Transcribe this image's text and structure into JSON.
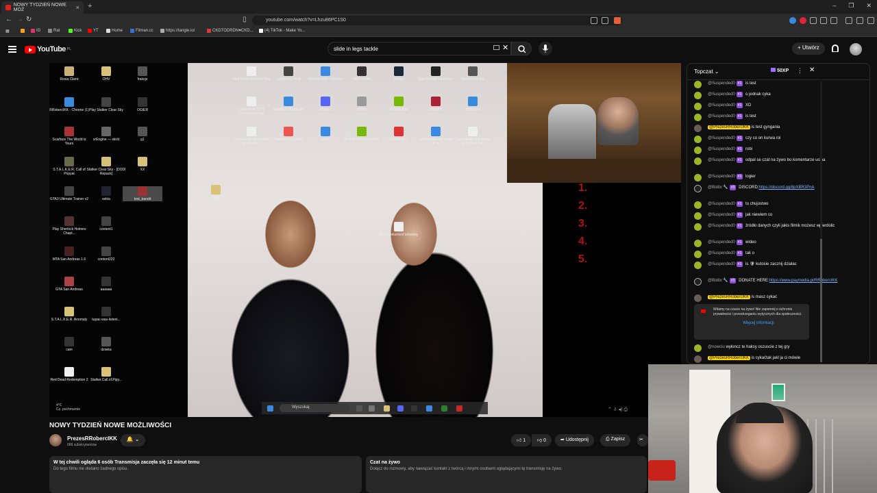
{
  "browser": {
    "tab_title": "NOWY TYDZIEŃ NOWE MOŻ",
    "tab_close": "×",
    "new_tab": "+",
    "url": "youtube.com/watch?v=Lhzu86PC1S0",
    "window_controls": [
      "–",
      "❐",
      "✕"
    ],
    "bookmarks": [
      {
        "label": "IG",
        "color": "#e1306c"
      },
      {
        "label": "Rat",
        "color": "#888888"
      },
      {
        "label": "Kick",
        "color": "#53fc18"
      },
      {
        "label": "YT",
        "color": "#ff0000"
      },
      {
        "label": "Home",
        "color": "#dddddd"
      },
      {
        "label": "Filman.cc",
        "color": "#3b6fd1"
      },
      {
        "label": "https://tangle.io/",
        "color": "#aaaaaa"
      },
      {
        "label": "CKDTODRDN♥CKD...",
        "color": "#d63a3a"
      },
      {
        "label": "(4) TikTok - Make Yo...",
        "color": "#ffffff"
      }
    ]
  },
  "youtube": {
    "logo_text": "YouTube",
    "logo_region": "PL",
    "search_value": "slide in legs tackle",
    "search_clear": "✕",
    "create_label": "Utwórz",
    "create_plus": "+"
  },
  "desktop": {
    "icons": [
      {
        "label": "Resia Client",
        "color": "#c9b27a"
      },
      {
        "label": "OHV",
        "color": "#d8c27a"
      },
      {
        "label": "frakcje",
        "color": "#555"
      },
      {
        "label": "RRobercIKK - Chrome (1)",
        "color": "#3a8be0"
      },
      {
        "label": "Play Stalker Clear Sky",
        "color": "#444"
      },
      {
        "label": "OGIER",
        "color": "#333"
      },
      {
        "label": "Scarface The World is Yours",
        "color": "#a33"
      },
      {
        "label": "xrEngine — skrót",
        "color": "#666"
      },
      {
        "label": "g1",
        "color": "#555"
      },
      {
        "label": "S.T.A.L.K.E.R. Call of Pripyat",
        "color": "#6a6a4a"
      },
      {
        "label": "Stalker Clear Sky - [DODI Repack]",
        "color": "#d8c27a"
      },
      {
        "label": "XX",
        "color": "#d8c27a"
      },
      {
        "label": "GTA3 Ultimate Trainer v2",
        "color": "#444"
      },
      {
        "label": "sekta",
        "color": "#223"
      },
      {
        "label": "test_bandit",
        "color": "#933"
      },
      {
        "label": "Play Sherlock Holmes Chapt...",
        "color": "#533"
      },
      {
        "label": "content1",
        "color": "#444"
      },
      {
        "label": "MTA San Andreas 1.6",
        "color": "#422"
      },
      {
        "label": "content222",
        "color": "#444"
      },
      {
        "label": "GTA San Andreas",
        "color": "#a44"
      },
      {
        "label": "aaaaaa",
        "color": "#333"
      },
      {
        "label": "S.T.A.L.K.E.R. Anomaly",
        "color": "#d8c27a"
      },
      {
        "label": "tupac-was-listeni...",
        "color": "#333"
      },
      {
        "label": "cam",
        "color": "#333"
      },
      {
        "label": "dziwka",
        "color": "#555"
      },
      {
        "label": "Red Dead Redemption 2",
        "color": "#eee"
      },
      {
        "label": "Stalker.Call.of.Pipy...",
        "color": "#d8c27a"
      },
      {
        "label": "cmd",
        "color": "#d8c27a"
      },
      {
        "label": "Red Dead Modding Tool",
        "color": "#eee"
      },
      {
        "label": "Logitech G HUB",
        "color": "#444"
      },
      {
        "label": "RRobercIKK - Chrome",
        "color": "#3a8be0"
      },
      {
        "label": "OBS Studio",
        "color": "#333"
      },
      {
        "label": "Steam",
        "color": "#1b2838"
      },
      {
        "label": "Epic Games Launcher",
        "color": "#222"
      },
      {
        "label": "SteelSeries GG",
        "color": "#555"
      },
      {
        "label": "CyberPunk 2077 Command's List",
        "color": "#eee"
      },
      {
        "label": "DAEMON Tools Lite",
        "color": "#3a8be0"
      },
      {
        "label": "Discord",
        "color": "#5865f2"
      },
      {
        "label": "Kosz",
        "color": "#999"
      },
      {
        "label": "NVIDIA App",
        "color": "#76b900"
      },
      {
        "label": "WinRAR",
        "color": "#a23"
      },
      {
        "label": "qBittorrent",
        "color": "#3a8be0"
      },
      {
        "label": "Commands and useful ID's Batch...",
        "color": "#eee"
      },
      {
        "label": "GameForge Client",
        "color": "#e55"
      },
      {
        "label": "Uplay",
        "color": "#3a8be0"
      },
      {
        "label": "NVIDIA GeForce NOW",
        "color": "#76b900"
      },
      {
        "label": "CCleaner 7",
        "color": "#d33"
      },
      {
        "label": "Commands and useful ID's",
        "color": "#3a8be0"
      },
      {
        "label": "Commands and useful IDS Plain Text",
        "color": "#eee"
      },
      {
        "label": "Nowy dokument tekstowy",
        "color": "#eee"
      }
    ],
    "taskbar_search": "Wyszukaj",
    "weather_temp": "4°C",
    "weather_desc": "Cz. pochmurnie",
    "donate_numbers": [
      "1.",
      "2.",
      "3.",
      "4.",
      "5."
    ]
  },
  "chat": {
    "title": "Topczat",
    "points": "50XP",
    "messages": [
      {
        "name": "@Suspended0",
        "badge": "#1",
        "text": "is test"
      },
      {
        "name": "@Suspended0",
        "badge": "#1",
        "text": "o jednak cyka"
      },
      {
        "name": "@Suspended0",
        "badge": "#1",
        "text": "XD"
      },
      {
        "name": "@Suspended0",
        "badge": "#1",
        "text": "is test"
      },
      {
        "name": "@PrezesRRobercIKK",
        "owner": true,
        "text": "is test gyngania"
      },
      {
        "name": "@Suspended0",
        "badge": "#1",
        "text": "czy co on kurwa roi"
      },
      {
        "name": "@Suspended0",
        "badge": "#1",
        "text": "robi"
      },
      {
        "name": "@Suspended0",
        "badge": "#1",
        "text": "odpal se czat na żywo bo komentarze ucina"
      },
      {
        "name": "@Suspended0",
        "badge": "#1",
        "text": "logier"
      },
      {
        "name": "@Botlix 🔧",
        "badge": "#3",
        "text": "DISCORD:",
        "link": "https://discord.gg/8pXBR3PnA"
      },
      {
        "name": "@Suspended0",
        "badge": "#1",
        "text": "to chujostwo"
      },
      {
        "name": "@Suspended0",
        "badge": "#1",
        "text": "jak niewiem co"
      },
      {
        "name": "@Suspended0",
        "badge": "#1",
        "text": "źródło danych czyli jakis filmik możesz wpierdolic"
      },
      {
        "name": "@Suspended0",
        "badge": "#1",
        "text": "wideo"
      },
      {
        "name": "@Suspended0",
        "badge": "#1",
        "text": "tak o"
      },
      {
        "name": "@Suspended0",
        "badge": "#1",
        "text": "is 🛡 kutosie zacznij działac"
      },
      {
        "name": "@Botlix 🔧",
        "badge": "#3",
        "text": "DONATE HERE:",
        "link": "https://www.paymedia.pl/RRobercIKK"
      },
      {
        "name": "@PrezesRRobercIKK",
        "owner": true,
        "text": "is masz cykać"
      }
    ],
    "notice_text": "Witamy na czacie na żywo! Nie zapomnij o ochronie prywatności i przestrzeganiu wytycznych dla społeczności.",
    "notice_more": "Więcej informacji",
    "after": [
      {
        "name": "@nowciu",
        "text": "wyłoncz te haksy oszuscie z tej gry"
      },
      {
        "name": "@PrezesRRobercIKK",
        "owner": true,
        "text": "is cykaćtak jakl ja ci mówie"
      }
    ]
  },
  "video": {
    "title": "NOWY TYDZIEŃ NOWE MOŻLIWOŚCI",
    "channel": "PrezesRRobercIKK",
    "subs": "688 subskrybentów",
    "bell_label": "🔔 ⌄",
    "likes": "1",
    "dislikes": "0",
    "share": "Udostępnij",
    "save": "Zapisz",
    "desc_head": "W tej chwili ogląda 6 osób  Transmisja zaczęła się 12 minut temu",
    "desc_sub": "Do tego filmu nie dodano żadnego opisu.",
    "chat_head": "Czat na żywo",
    "chat_sub": "Dołącz do rozmowy, aby nawiązać kontakt z twórcą i innymi osobami oglądającymi tę transmisję na żywo."
  }
}
